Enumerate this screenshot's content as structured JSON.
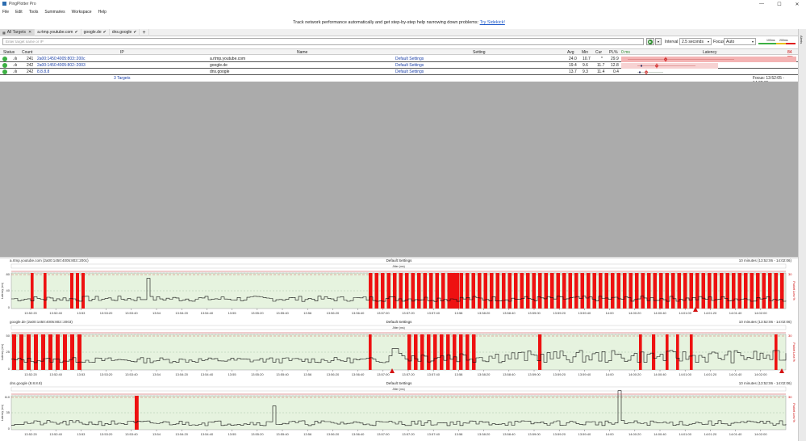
{
  "window": {
    "title": "PingPlotter Pro",
    "minimize": "—",
    "maximize": "☐",
    "close": "✕"
  },
  "menu": [
    "File",
    "Edit",
    "Tools",
    "Summaries",
    "Workspace",
    "Help"
  ],
  "banner": {
    "text": "Track network performance automatically and get step-by-step help narrowing down problems:",
    "link": "Try Sidekick!"
  },
  "tabs": [
    {
      "label": "All Targets",
      "active": true
    },
    {
      "label": "a.rtmp.youtube.com"
    },
    {
      "label": "google.de"
    },
    {
      "label": "dns.google"
    }
  ],
  "toolbar": {
    "target_placeholder": "Enter target name or IP",
    "interval_label": "Interval",
    "interval_value": "2.5 seconds",
    "focus_label": "Focus",
    "focus_value": "Auto",
    "scale_100": "100ms",
    "scale_200": "200ms"
  },
  "sidebar": {
    "label": "Alerts"
  },
  "grid": {
    "headers": {
      "status": "Status",
      "count": "Count",
      "ip": "IP",
      "name": "Name",
      "setting": "Setting",
      "avg": "Avg",
      "min": "Min",
      "cur": "Cur",
      "pl": "PL%",
      "zero": "0 ms",
      "latency": "Latency",
      "max": "84 ms"
    },
    "rows": [
      {
        "status": "ok",
        "count": "241",
        "ip": "2a00:1450:4005:803::200c",
        "name": "a.rtmp.youtube.com",
        "setting": "Default Settings",
        "avg": "24.0",
        "min": "10.7",
        "cur": "*",
        "pl": "29.9"
      },
      {
        "status": "ok",
        "count": "242",
        "ip": "2a00:1450:4005:802::2003",
        "name": "google.de",
        "setting": "Default Settings",
        "avg": "19.4",
        "min": "9.6",
        "cur": "11.7",
        "pl": "12.8"
      },
      {
        "status": "ok",
        "count": "242",
        "ip": "8.8.8.8",
        "name": "dns.google",
        "setting": "Default Settings",
        "avg": "13.7",
        "min": "9.3",
        "cur": "11.4",
        "pl": "0.4"
      }
    ],
    "footer_targets": "3 Targets",
    "footer_focus": "Focus: 13:52:05 - 14:02:05"
  },
  "graphs": [
    {
      "title": "a.rtmp.youtube.com (2a00:1450:4005:803::200c)",
      "setting": "Default Settings",
      "range": "10 minutes (13:52:06 - 14:02:06)",
      "ymax": "80",
      "ymid": "40",
      "ymin": "0",
      "pl_max": "30",
      "pl_label": "Packet Loss %",
      "y_label": "Latency (ms)",
      "jitter": "Jitter (ms)",
      "x_ticks": [
        "13:52:20",
        "13:52:40",
        "13:53",
        "13:53:20",
        "13:53:40",
        "13:54",
        "13:54:20",
        "13:54:40",
        "13:55",
        "13:55:20",
        "13:55:40",
        "13:56",
        "13:56:20",
        "13:56:40",
        "13:57:00",
        "13:57:20",
        "13:57:40",
        "13:58",
        "13:58:20",
        "13:58:40",
        "13:59:00",
        "13:59:20",
        "13:59:40",
        "14:00",
        "14:00:20",
        "14:00:40",
        "14:01:00",
        "14:01:20",
        "14:01:40",
        "14:02:00"
      ]
    },
    {
      "title": "google.de (2a00:1450:4005:802::2003)",
      "setting": "Default Settings",
      "range": "10 minutes (13:52:06 - 14:02:06)",
      "ymax": "50",
      "ymid": "25",
      "ymin": "0",
      "pl_max": "30",
      "pl_label": "Packet Loss %",
      "y_label": "Latency (ms)",
      "jitter": "Jitter (ms)",
      "x_ticks": [
        "13:52:20",
        "13:52:40",
        "13:53",
        "13:53:20",
        "13:53:40",
        "13:54",
        "13:54:20",
        "13:54:40",
        "13:55",
        "13:55:20",
        "13:55:40",
        "13:56",
        "13:56:20",
        "13:56:40",
        "13:57:00",
        "13:57:20",
        "13:57:40",
        "13:58",
        "13:58:20",
        "13:58:40",
        "13:59:00",
        "13:59:20",
        "13:59:40",
        "14:00",
        "14:00:20",
        "14:00:40",
        "14:01:00",
        "14:01:20",
        "14:01:40",
        "14:02:00"
      ]
    },
    {
      "title": "dns.google (8.8.8.8)",
      "setting": "Default Settings",
      "range": "10 minutes (13:52:06 - 14:02:06)",
      "ymax": "110",
      "ymid": "35",
      "ymin": "0",
      "pl_max": "30",
      "pl_label": "Packet Loss %",
      "y_label": "Latency (ms)",
      "jitter": "Jitter (ms)",
      "x_ticks": [
        "13:52:20",
        "13:52:40",
        "13:53",
        "13:53:20",
        "13:53:40",
        "13:54",
        "13:54:20",
        "13:54:40",
        "13:55",
        "13:55:20",
        "13:55:40",
        "13:56",
        "13:56:20",
        "13:56:40",
        "13:57:00",
        "13:57:20",
        "13:57:40",
        "13:58",
        "13:58:20",
        "13:58:40",
        "13:59:00",
        "13:59:20",
        "13:59:40",
        "14:00",
        "14:00:20",
        "14:00:40",
        "14:01:00",
        "14:01:20",
        "14:01:40",
        "14:02:00"
      ]
    }
  ],
  "colors": {
    "plot_bg": "#e6f3df",
    "loss": "#ee1111",
    "line": "#111111",
    "tab_bar": "#f0f0f0",
    "gray": "#ababab",
    "latency_row1": "#f4b4b4",
    "latency_row2": "#f7d2d2"
  }
}
